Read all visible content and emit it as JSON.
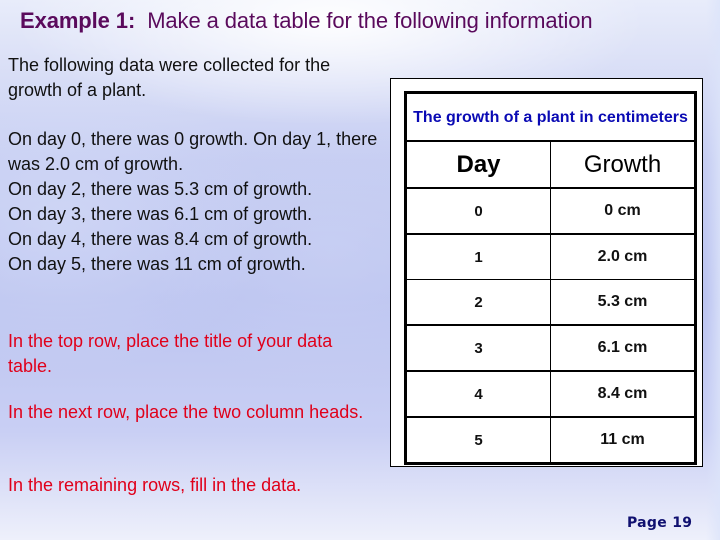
{
  "slide": {
    "title_bold": "Example 1:",
    "title_rest": "  Make a data table for the following information",
    "intro_text": "The following data were collected for the growth of a plant.",
    "facts": [
      "On day 0, there was 0 growth. On day 1, there was 2.0 cm of growth.",
      "On day 2, there was 5.3 cm of growth.",
      "On day 3, there was 6.1 cm of growth.",
      "On day 4, there was 8.4 cm of growth.",
      "On day 5, there was 11 cm of growth."
    ],
    "instructions": [
      "In the top row, place the title of your data table.",
      "In the next row, place the two column heads.",
      "In the remaining rows, fill in the data."
    ],
    "page_label": "Page 19"
  },
  "table": {
    "title": "The growth of a plant in centimeters",
    "columns": [
      "Day",
      "Growth"
    ],
    "rows": [
      [
        "0",
        "0 cm"
      ],
      [
        "1",
        "2.0 cm"
      ],
      [
        "2",
        "5.3 cm"
      ],
      [
        "3",
        "6.1 cm"
      ],
      [
        "4",
        "8.4 cm"
      ],
      [
        "5",
        "11 cm"
      ]
    ]
  },
  "colors": {
    "title": "#5a0a5c",
    "instruction_text": "#e0001a",
    "table_title": "#0a0ab4",
    "page_number": "#101070"
  }
}
